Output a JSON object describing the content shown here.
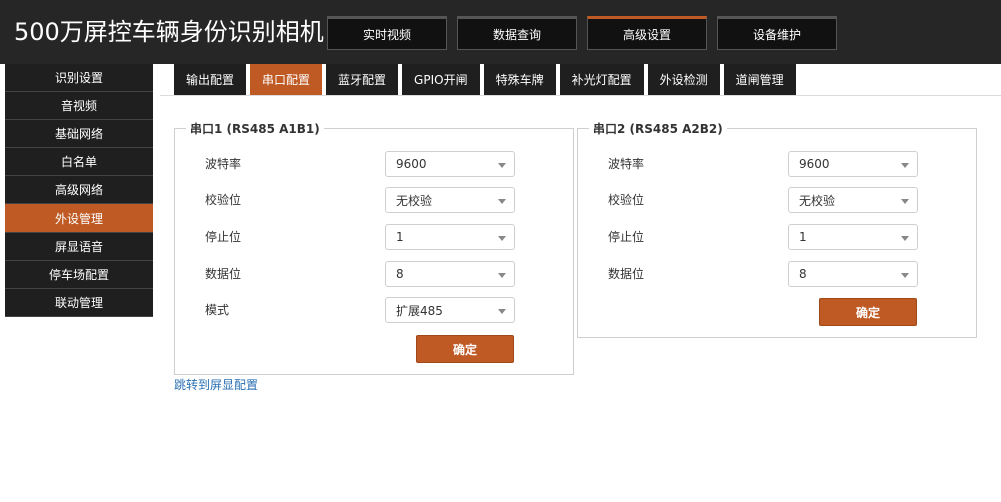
{
  "app": {
    "title": "500万屏控车辆身份识别相机"
  },
  "top_nav": [
    "实时视频",
    "数据查询",
    "高级设置",
    "设备维护"
  ],
  "sidebar": [
    "识别设置",
    "音视频",
    "基础网络",
    "白名单",
    "高级网络",
    "外设管理",
    "屏显语音",
    "停车场配置",
    "联动管理"
  ],
  "subtabs": [
    "输出配置",
    "串口配置",
    "蓝牙配置",
    "GPIO开闸",
    "特殊车牌",
    "补光灯配置",
    "外设检测",
    "道闸管理"
  ],
  "serial1": {
    "legend": "串口1 (RS485 A1B1)",
    "fields": [
      {
        "label": "波特率",
        "value": "9600"
      },
      {
        "label": "校验位",
        "value": "无校验"
      },
      {
        "label": "停止位",
        "value": "1"
      },
      {
        "label": "数据位",
        "value": "8"
      },
      {
        "label": "模式",
        "value": "扩展485"
      }
    ],
    "confirm_label": "确定"
  },
  "serial2": {
    "legend": "串口2 (RS485 A2B2)",
    "fields": [
      {
        "label": "波特率",
        "value": "9600"
      },
      {
        "label": "校验位",
        "value": "无校验"
      },
      {
        "label": "停止位",
        "value": "1"
      },
      {
        "label": "数据位",
        "value": "8"
      }
    ],
    "confirm_label": "确定"
  },
  "link": {
    "text": "跳转到屏显配置"
  },
  "colors": {
    "accent": "#bf5a25",
    "dark": "#1f1f1f",
    "link": "#2a6fb3"
  }
}
